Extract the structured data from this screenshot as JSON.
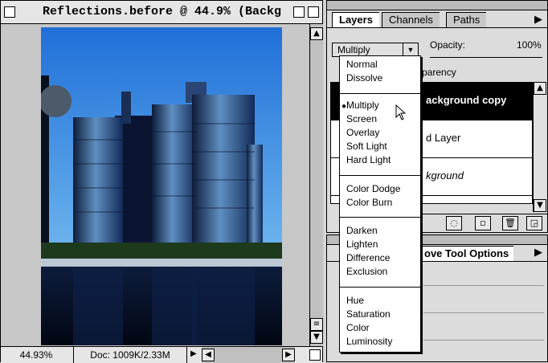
{
  "document_window": {
    "title": "Reflections.before @ 44.9% (Backg",
    "zoom": "44.93%",
    "doc_info": "Doc: 1009K/2.33M"
  },
  "layers_palette": {
    "tabs": [
      "Layers",
      "Channels",
      "Paths"
    ],
    "active_tab": "Layers",
    "blend_mode": "Multiply",
    "opacity_label": "Opacity:",
    "opacity_value": "100%",
    "preserve_transparency_partial": "parency",
    "layers": [
      {
        "name_partial": "ackground copy",
        "selected": true
      },
      {
        "name_partial": "d Layer",
        "selected": false
      },
      {
        "name_partial": "kground",
        "selected": false
      }
    ]
  },
  "options_palette": {
    "tab": "ove Tool Options"
  },
  "blend_menu": {
    "items": [
      "Normal",
      "Dissolve",
      "Multiply",
      "Screen",
      "Overlay",
      "Soft Light",
      "Hard Light",
      "Color Dodge",
      "Color Burn",
      "Darken",
      "Lighten",
      "Difference",
      "Exclusion",
      "Hue",
      "Saturation",
      "Color",
      "Luminosity"
    ],
    "checked": "Multiply"
  }
}
